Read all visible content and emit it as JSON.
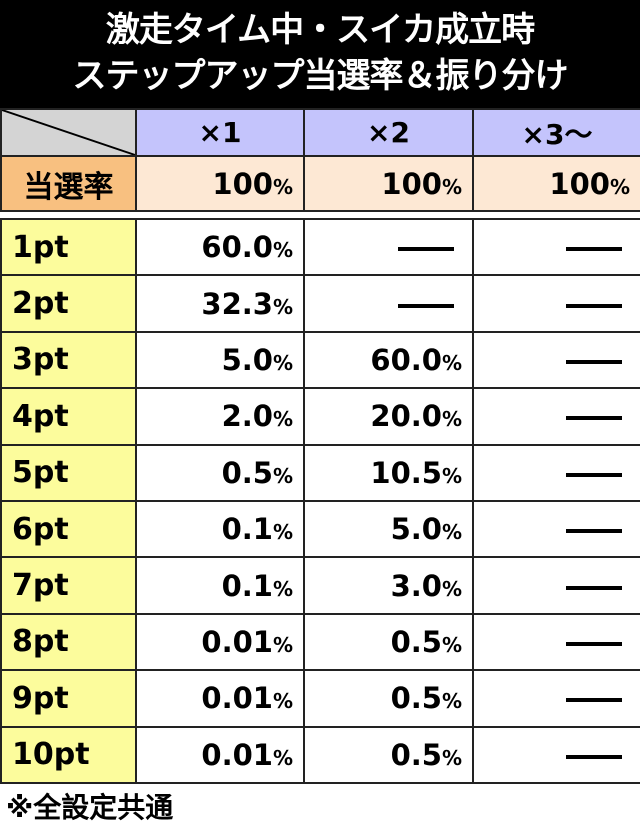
{
  "title": {
    "line1": "激走タイム中・スイカ成立時",
    "line2": "ステップアップ当選率＆振り分け"
  },
  "header": {
    "columns": [
      "×1",
      "×2",
      "×3～"
    ]
  },
  "win_rate": {
    "label": "当選率",
    "values": [
      "100",
      "100",
      "100"
    ],
    "unit": "%"
  },
  "rows": [
    {
      "label": "1pt",
      "values": [
        "60.0",
        null,
        null
      ]
    },
    {
      "label": "2pt",
      "values": [
        "32.3",
        null,
        null
      ]
    },
    {
      "label": "3pt",
      "values": [
        "5.0",
        "60.0",
        null
      ]
    },
    {
      "label": "4pt",
      "values": [
        "2.0",
        "20.0",
        null
      ]
    },
    {
      "label": "5pt",
      "values": [
        "0.5",
        "10.5",
        null
      ]
    },
    {
      "label": "6pt",
      "values": [
        "0.1",
        "5.0",
        null
      ]
    },
    {
      "label": "7pt",
      "values": [
        "0.1",
        "3.0",
        null
      ]
    },
    {
      "label": "8pt",
      "values": [
        "0.01",
        "0.5",
        null
      ]
    },
    {
      "label": "9pt",
      "values": [
        "0.01",
        "0.5",
        null
      ]
    },
    {
      "label": "10pt",
      "values": [
        "0.01",
        "0.5",
        null
      ]
    }
  ],
  "unit": "%",
  "none_mark": "dash",
  "footnote": "※全設定共通",
  "colors": {
    "title_bg": "#000000",
    "corner_bg": "#d4d4d4",
    "header_bg": "#c4c4fc",
    "rate_label_bg": "#f8c080",
    "rate_bg": "#fde8d4",
    "pt_bg": "#fcfc9c"
  }
}
